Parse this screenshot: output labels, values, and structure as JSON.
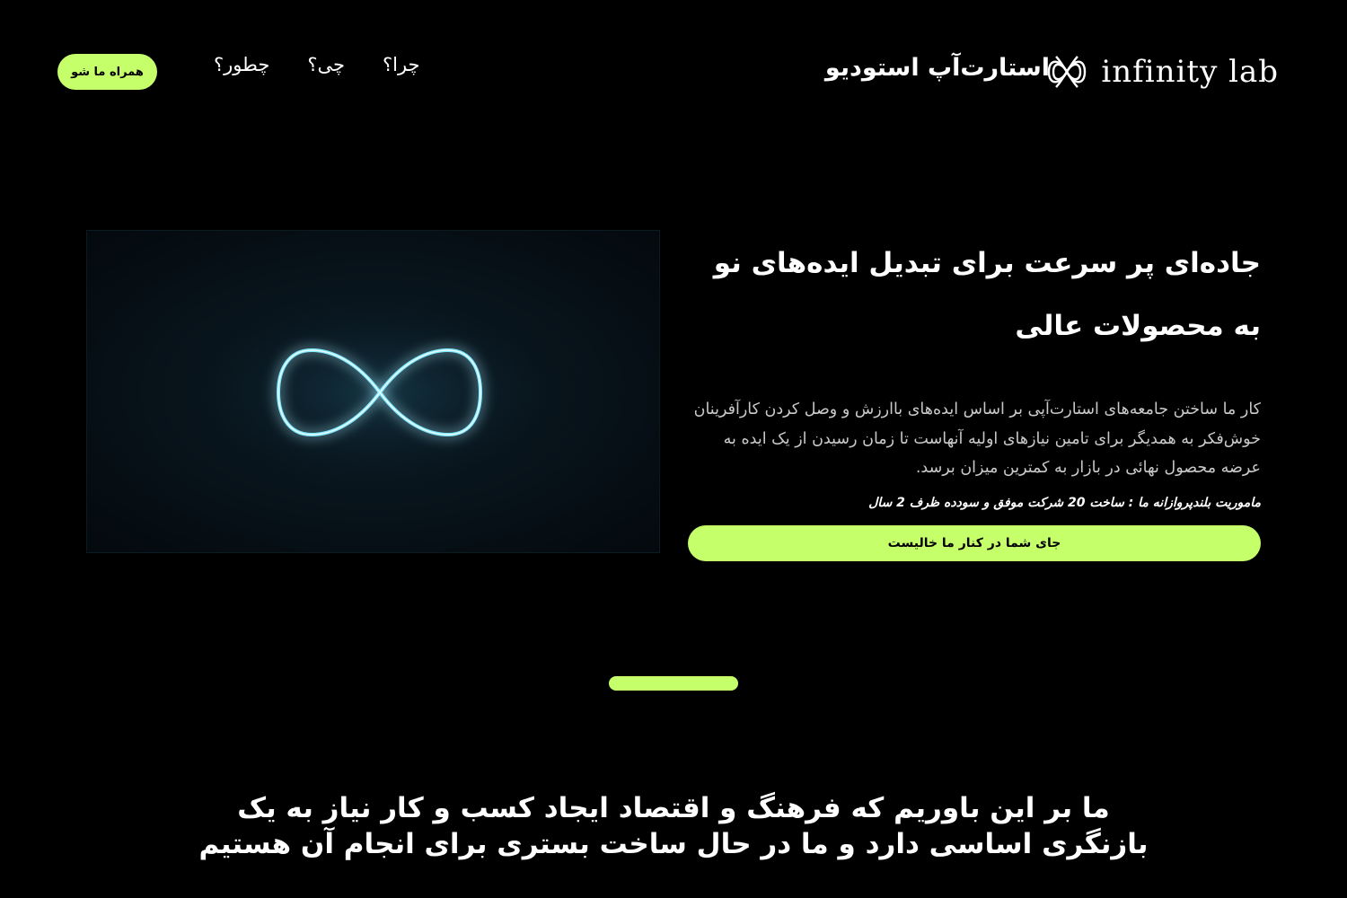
{
  "header": {
    "brand_fa": "استارت‌آپ استودیو",
    "brand_en": "infinity lab",
    "logo_icon": "infinity-knot-logo",
    "nav": [
      {
        "label": "چرا؟"
      },
      {
        "label": "چی؟"
      },
      {
        "label": "چطور؟"
      }
    ],
    "join_label": "همراه ما شو"
  },
  "hero": {
    "image_subject": "glowing-infinity-sign",
    "title": "جاده‌ای پر سرعت برای تبدیل ایده‌های نو به محصولات عالی",
    "description": "کار ما ساختن جامعه‌های استارت‌آپی بر اساس ایده‌های باارزش و وصل کردن کارآفرینان خوش‌فکر به همدیگر برای تامین نیازهای اولیه آنهاست تا زمان رسیدن از یک ایده به عرضه محصول نهائی در بازار به کمترین میزان برسد.",
    "mission": "ماموریت بلندپروازانه ما : ساخت 20 شرکت موفق و سودده ظرف 2 سال",
    "cta_label": "جای شما در کنار ما خالیست"
  },
  "belief": "ما بر این باوریم که فرهنگ و اقتصاد ایجاد کسب و کار نیاز به یک بازنگری اساسی دارد و ما در حال ساخت بستری برای انجام آن هستیم",
  "colors": {
    "accent": "#c5ff6a",
    "background": "#000000",
    "glow": "#6fe6ff"
  }
}
